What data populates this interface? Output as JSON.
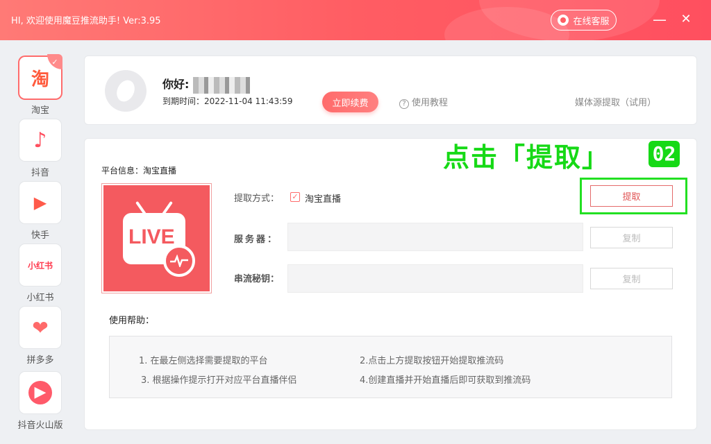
{
  "window": {
    "title": "HI, 欢迎使用魔豆推流助手! Ver:3.95",
    "customer_service": "在线客服",
    "minimize_glyph": "—",
    "close_glyph": "✕",
    "accent_color": "#ff5d63"
  },
  "sidebar": {
    "items": [
      {
        "label": "淘宝",
        "glyph": "淘",
        "icon": "taobao-icon",
        "active": true
      },
      {
        "label": "抖音",
        "glyph": "♪",
        "icon": "douyin-icon"
      },
      {
        "label": "快手",
        "glyph": "▶",
        "icon": "kuaishou-icon"
      },
      {
        "label": "小红书",
        "glyph": "小红书",
        "icon": "xiaohongshu-icon"
      },
      {
        "label": "拼多多",
        "glyph": "❤",
        "icon": "pinduoduo-icon"
      },
      {
        "label": "抖音火山版",
        "glyph": "▶",
        "icon": "huoshan-icon"
      }
    ]
  },
  "profile": {
    "greeting": "你好:",
    "expire": "到期时间：2022-11-04 11:43:59",
    "renew_label": "立即续费",
    "tutorial_label": "使用教程",
    "tutorial_glyph": "?",
    "media_extract_label": "媒体源提取（试用）"
  },
  "main": {
    "platform_info": "平台信息：淘宝直播",
    "live_text": "LIVE",
    "method_label": "提取方式：",
    "method_checked": "✓",
    "method_value": "淘宝直播",
    "server_label": "服务器：",
    "key_label": "串流秘钥：",
    "extract_label": "提取",
    "copy_label": "复制",
    "annotation": "点击「提取」",
    "annotation_step": "02",
    "help_title": "使用帮助：",
    "help_items": [
      "1. 在最左侧选择需要提取的平台",
      "2.点击上方提取按钮开始提取推流码",
      "3. 根据操作提示打开对应平台直播伴侣",
      "4.创建直播并开始直播后即可获取到推流码"
    ]
  }
}
